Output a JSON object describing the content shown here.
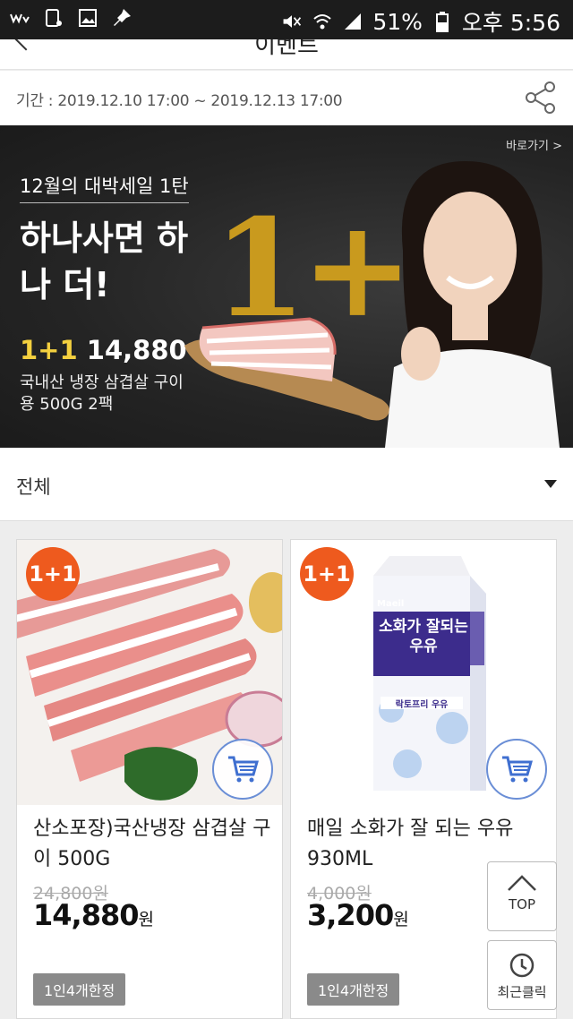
{
  "status_bar": {
    "battery": "51%",
    "time": "오후 5:56"
  },
  "header": {
    "title": "이벤트"
  },
  "event": {
    "period": "기간 : 2019.12.10 17:00 ~ 2019.12.13 17:00"
  },
  "banner": {
    "go_link": "바로가기 >",
    "subtitle": "12월의 대박세일 1탄",
    "headline": "하나사면 하나 더!",
    "big_text": "1+1",
    "price_prefix": "1+1",
    "price": "14,880",
    "description": "국내산 냉장 삼겹살 구이용 500G 2팩"
  },
  "filter": {
    "selected": "전체"
  },
  "products": [
    {
      "badge": "1+1",
      "name": "산소포장)국산냉장 삼겹살 구이 500G",
      "original_price": "24,800원",
      "sale_price": "14,880",
      "currency": "원",
      "limit": "1인4개한정"
    },
    {
      "badge": "1+1",
      "name": "매일 소화가 잘 되는 우유 930ML",
      "original_price": "4,000원",
      "sale_price": "3,200",
      "currency": "원",
      "limit": "1인4개한정",
      "package_brand": "Maeil",
      "package_title": "소화가 잘되는 우유",
      "package_sub": "락토프리 우유"
    }
  ],
  "float": {
    "top_label": "TOP",
    "recent_label": "최근클릭"
  },
  "colors": {
    "badge": "#ee5a1e",
    "cart_ring": "#6a8ed6",
    "banner_gold": "#c99a1e"
  }
}
